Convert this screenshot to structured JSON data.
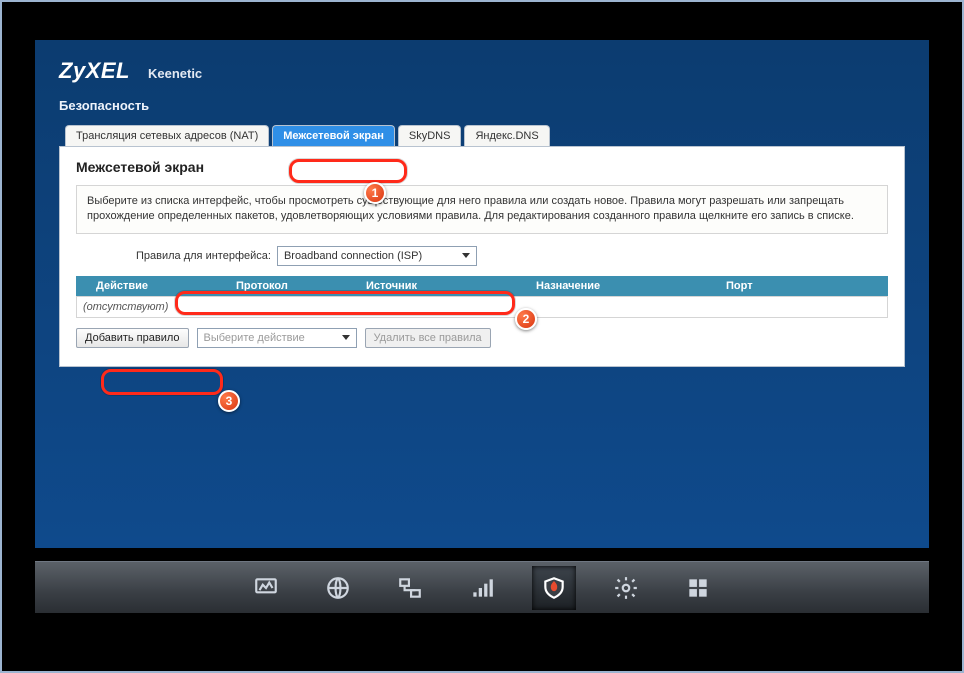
{
  "brand": {
    "logo": "ZyXEL",
    "product": "Keenetic"
  },
  "section": "Безопасность",
  "tabs": [
    {
      "label": "Трансляция сетевых адресов (NAT)",
      "active": false
    },
    {
      "label": "Межсетевой экран",
      "active": true
    },
    {
      "label": "SkyDNS",
      "active": false
    },
    {
      "label": "Яндекс.DNS",
      "active": false
    }
  ],
  "panel": {
    "heading": "Межсетевой экран",
    "info": "Выберите из списка интерфейс, чтобы просмотреть существующие для него правила или создать новое. Правила могут разрешать или запрещать прохождение определенных пакетов, удовлетворяющих условиями правила. Для редактирования созданного правила щелкните его запись в списке.",
    "interface_label": "Правила для интерфейса:",
    "interface_value": "Broadband connection (ISP)"
  },
  "columns": {
    "action": "Действие",
    "protocol": "Протокол",
    "source": "Источник",
    "destination": "Назначение",
    "port": "Порт"
  },
  "empty_row": "(отсутствуют)",
  "buttons": {
    "add": "Добавить правило",
    "select_action_placeholder": "Выберите действие",
    "delete_all": "Удалить все правила"
  },
  "taskbar_icons": {
    "monitor": "monitor-icon",
    "globe": "globe-icon",
    "network": "network-icon",
    "wifi": "wifi-icon",
    "firewall": "firewall-icon",
    "settings": "gear-icon",
    "apps": "apps-icon"
  },
  "annotations": {
    "1": "1",
    "2": "2",
    "3": "3"
  }
}
